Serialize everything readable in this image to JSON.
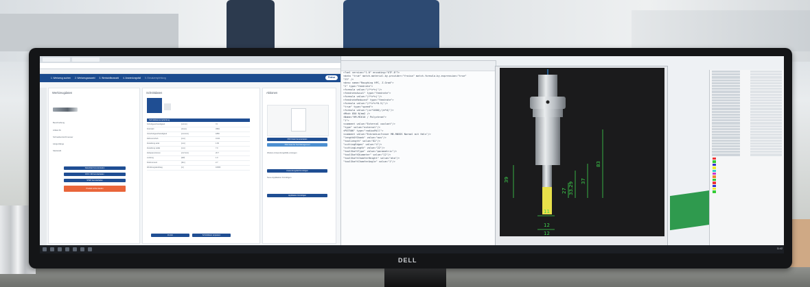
{
  "monitor": {
    "brand": "DELL"
  },
  "browser": {
    "steps": [
      "1. Werkzeug suchen",
      "2. Werkzeugauswahl",
      "3. Werkstoffauswahl",
      "4. Anwendungsfall",
      "5. Einsatzempfehlung"
    ],
    "brand": "Fraisa",
    "col_titles": [
      "Werkzeugdaten",
      "Schnittdaten",
      "Aktionen"
    ],
    "tool_meta": [
      "Beschreibung",
      "Artikel-Nr.",
      "Schneidendurchmesser",
      "Längenlänge",
      "Stückzahl"
    ],
    "left_buttons": [
      "Datenblatt herunterladen",
      "DXF / 3D herunterladen",
      "STEP herunterladen"
    ],
    "orange_button": "Produkt online kaufen",
    "table_header": "Schnittdatenempfehlung",
    "table_rows": [
      [
        "Schnittgeschwindigkeit",
        "[m/min]",
        "72"
      ],
      [
        "Drehzahl",
        "[1/min]",
        "4584"
      ],
      [
        "Vorschubgeschwindigkeit",
        "[mm/min]",
        "1850"
      ],
      [
        "Zahnvorschub",
        "[mm]",
        "0.101"
      ],
      [
        "Zustellung axial",
        "[mm]",
        "1.60"
      ],
      [
        "Zustellung radial",
        "[mm]",
        "7.0"
      ],
      [
        "Zeitspanvolumen",
        "[cm³/min]",
        "20.7"
      ],
      [
        "Leistung",
        "[kW]",
        "1.0"
      ],
      [
        "Drehmoment",
        "[Nm]",
        "2.7"
      ],
      [
        "Werkzeugstandweg",
        "[m]",
        "10000"
      ]
    ],
    "right_buttons": [
      "PDF Datei herunterladen",
      "XML Datei für Tool Management"
    ],
    "right_button_2": "Anwendungsfall hinzufügen",
    "right_button_3": "Applikation hinzufügen",
    "footer_buttons": [
      "Zurück",
      "Schnittdaten anpassen"
    ],
    "actions_labels": [
      "Weitere Anwendungsfälle anzeigen",
      "Neue Applikation hinzufügen"
    ]
  },
  "xml": {
    "lines": [
      "<?xml version=\"1.0\" encoding=\"UTF-8\"?>",
      "<data \"true\" match-material-by-provider=\"fraisa\" match-formula-by-expression=\"true\"",
      "  \"23\" />",
      "<desc name=\"Roughing HPC, Z-Grad\">",
      "",
      "  \"2\" type=\"feedrate\">",
      "  <formula value=\"(f*z*n)\"/>",
      "",
      "  <feedrateAxial\" type=\"feedrate\">",
      "  <formula value=\"(f*z*n)\"/>",
      "",
      "  <feedrateReduced\" type=\"feedrate\">",
      "  <formula value=\"(f*z*n*0.5)\"/>",
      "",
      "  \"true\" type=\"speed\">",
      "  <formula value=\"(vc*1000)/(π*d)\"/>",
      "",
      "<Mhd< 850 N/mm2 />",
      "",
      "<Name=\"HM-MI610 / Polychrom\">",
      "",
      "  \"1\">",
      "  <comment value=\"External coolant\"/>",
      "  \"type\" value=\"external\"/>",
      "",
      "<P0750K\" type=\"radiusMill\">",
      "  <comment value=\"Eckradiusfraser MB-RNVDS Normal mit Hals\"/>",
      "  \"lengthOfShank\" value=\"aus\"/>",
      "  \"toolLength\" value=\"82\"/>",
      "  \"cuttingEdges\" value=\"4\"/>",
      "  \"cuttingLength\" value=\"22\"/>",
      "  \"toolShaftType\" value=\"parametric\"/>",
      "  \"toolShaftDiameter\" value=\"12\"/>",
      "  \"toolShaftChamferHeight\" value=\"aha\"/>",
      "  \"toolShaftChamferAngle\" value=\"1\"/>"
    ]
  },
  "cad": {
    "dimensions": [
      "39",
      "27",
      "33.29",
      "37",
      "83",
      "11",
      "12",
      "12"
    ]
  },
  "taskbar": {
    "time": "11:42"
  }
}
